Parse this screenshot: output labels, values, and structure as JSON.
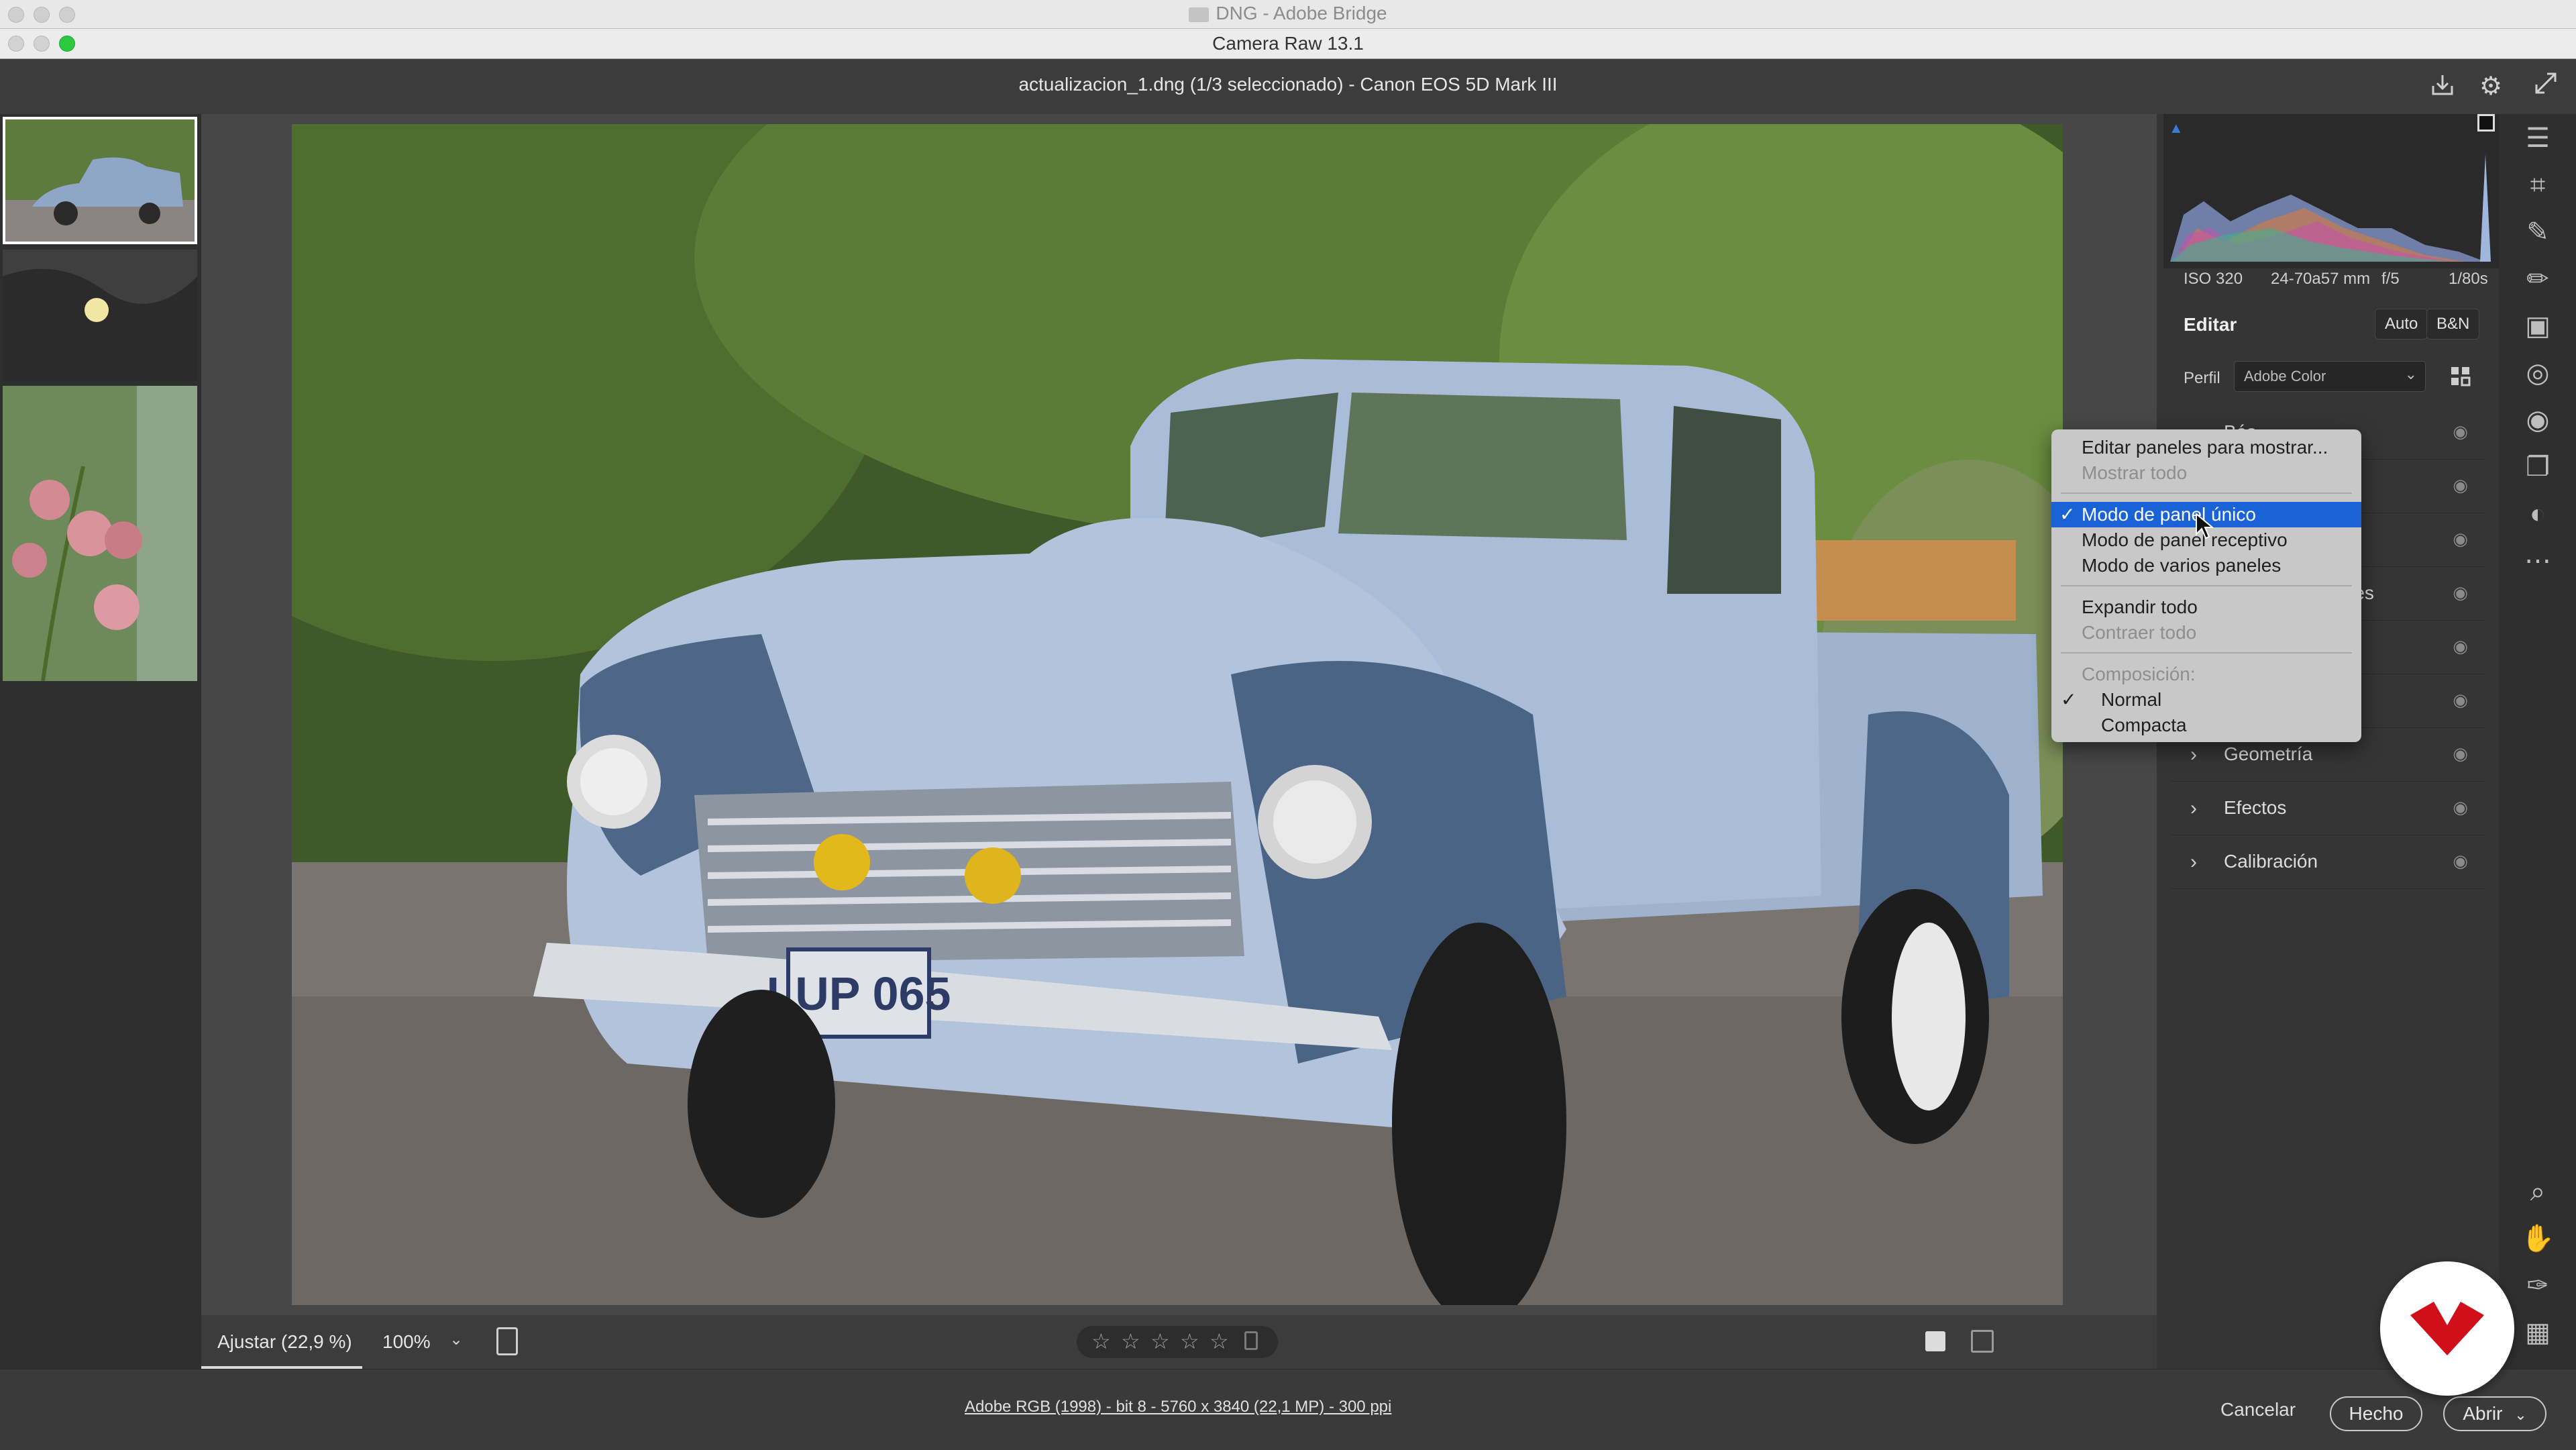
{
  "bridge_window": {
    "title": "DNG - Adobe Bridge"
  },
  "window": {
    "title": "Camera Raw 13.1"
  },
  "header": {
    "filename": "actualizacion_1.dng (1/3 seleccionado) -  Canon EOS 5D Mark III"
  },
  "camera_info": {
    "iso": "ISO 320",
    "lens": "24-70a57 mm",
    "aperture": "f/5",
    "shutter": "1/80s"
  },
  "edit": {
    "title": "Editar",
    "auto_label": "Auto",
    "bw_label": "B&N",
    "profile_label": "Perfil",
    "profile_value": "Adobe Color"
  },
  "panels": [
    {
      "label": "Básico",
      "visible_fragment": "Bás"
    },
    {
      "label": "",
      "visible_fragment": ""
    },
    {
      "label": "",
      "visible_fragment": ""
    },
    {
      "label": "",
      "visible_fragment": "res"
    },
    {
      "label": "",
      "visible_fragment": "r"
    },
    {
      "label": "",
      "visible_fragment": ""
    },
    {
      "label": "Geometría"
    },
    {
      "label": "Efectos"
    },
    {
      "label": "Calibración"
    }
  ],
  "context_menu": {
    "items": [
      {
        "label": "Editar paneles para mostrar...",
        "enabled": true
      },
      {
        "label": "Mostrar todo",
        "enabled": false
      },
      {
        "label": "Modo de panel único",
        "enabled": true,
        "checked": true,
        "selected": true
      },
      {
        "label": "Modo de panel receptivo",
        "enabled": true
      },
      {
        "label": "Modo de varios paneles",
        "enabled": true
      },
      {
        "label": "Expandir todo",
        "enabled": true
      },
      {
        "label": "Contraer todo",
        "enabled": false
      },
      {
        "label": "Composición:",
        "enabled": false
      },
      {
        "label": "Normal",
        "enabled": true,
        "checked": true
      },
      {
        "label": "Compacta",
        "enabled": true
      }
    ]
  },
  "bottom_bar": {
    "fit_label": "Ajustar (22,9 %)",
    "zoom_label": "100%"
  },
  "footer": {
    "info_link": "Adobe RGB (1998) - bit 8 - 5760 x 3840 (22,1 MP) - 300 ppi",
    "cancel_label": "Cancelar",
    "done_label": "Hecho",
    "open_label": "Abrir"
  },
  "photo": {
    "plate_text": "LUP 065"
  },
  "colors": {
    "menu_selected": "#1a63d6",
    "menu_bg": "#c8c8c8",
    "panel_bg": "#353535",
    "logo_red": "#d10f1a"
  }
}
